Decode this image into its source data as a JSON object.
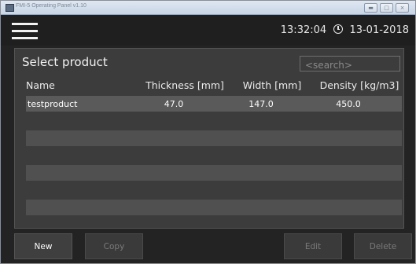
{
  "window": {
    "title": "FMI-5 Operating Panel v1.10"
  },
  "header": {
    "time": "13:32:04",
    "date": "13-01-2018"
  },
  "panel": {
    "title": "Select product",
    "search_placeholder": "<search>"
  },
  "table": {
    "columns": [
      "Name",
      "Thickness [mm]",
      "Width [mm]",
      "Density [kg/m3]"
    ],
    "rows": [
      {
        "name": "testproduct",
        "thickness": "47.0",
        "width": "147.0",
        "density": "450.0"
      }
    ]
  },
  "buttons": {
    "new": "New",
    "copy": "Copy",
    "edit": "Edit",
    "delete": "Delete"
  }
}
